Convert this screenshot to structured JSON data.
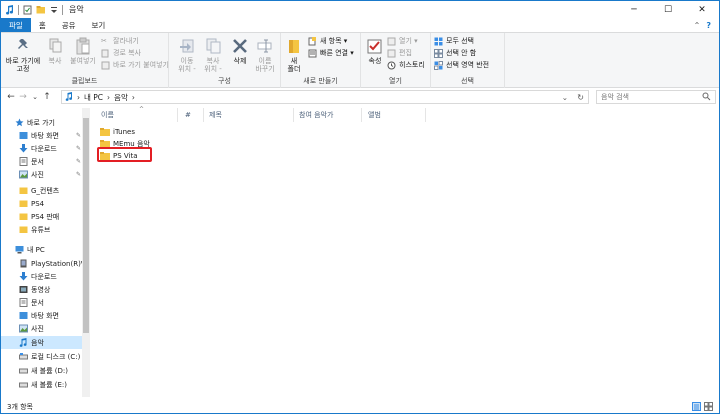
{
  "window": {
    "title": "음악",
    "minimize": "─",
    "maximize": "☐",
    "close": "✕"
  },
  "tabs": [
    {
      "label": "파일"
    },
    {
      "label": "홈"
    },
    {
      "label": "공유"
    },
    {
      "label": "보기"
    }
  ],
  "tabs_right": {
    "collapse": "⌃",
    "help": "?"
  },
  "ribbon": {
    "clipboard": {
      "pin_label": "바로 가기에\n고정",
      "copy_label": "복사",
      "paste_label": "붙여넣기",
      "cut_label": "잘라내기",
      "copy_path_label": "경로 복사",
      "paste_shortcut_label": "바로 가기 붙여넣기",
      "group_label": "클립보드"
    },
    "organize": {
      "move_label": "이동\n위치 -",
      "copy_to_label": "복사\n위치 -",
      "delete_label": "삭제",
      "rename_label": "이름\n바꾸기",
      "group_label": "구성"
    },
    "new": {
      "folder_label": "새\n폴더",
      "new_item_label": "새 항목 ▾",
      "easy_access_label": "빠른 연결 ▾",
      "group_label": "새로 만들기"
    },
    "open": {
      "properties_label": "속성",
      "open_label": "열기 ▾",
      "edit_label": "편집",
      "history_label": "히스토리",
      "group_label": "열기"
    },
    "select": {
      "select_all_label": "모두 선택",
      "select_none_label": "선택 안 함",
      "invert_label": "선택 영역 반전",
      "group_label": "선택"
    }
  },
  "address": {
    "back": "←",
    "forward": "→",
    "recent": "⌄",
    "up": "↑",
    "path": [
      "내 PC",
      "음악"
    ],
    "sep": "›",
    "dropdown": "⌄",
    "refresh": "↻",
    "search_placeholder": "음악 검색"
  },
  "nav": {
    "items": [
      {
        "label": "바로 가기",
        "pin": ""
      },
      {
        "label": "바탕 화면",
        "pin": "✎"
      },
      {
        "label": "다운로드",
        "pin": "✎"
      },
      {
        "label": "문서",
        "pin": "✎"
      },
      {
        "label": "사진",
        "pin": "✎"
      },
      {
        "label": "G_컨텐츠",
        "pin": ""
      },
      {
        "label": "PS4",
        "pin": ""
      },
      {
        "label": "PS4 판매",
        "pin": ""
      },
      {
        "label": "유튜브",
        "pin": ""
      },
      {
        "label": "내 PC",
        "pin": ""
      },
      {
        "label": "PlayStation(R)Vi",
        "pin": ""
      },
      {
        "label": "다운로드",
        "pin": ""
      },
      {
        "label": "동영상",
        "pin": ""
      },
      {
        "label": "문서",
        "pin": ""
      },
      {
        "label": "바탕 화면",
        "pin": ""
      },
      {
        "label": "사진",
        "pin": ""
      },
      {
        "label": "음악",
        "pin": ""
      },
      {
        "label": "로컬 디스크 (C:)",
        "pin": ""
      },
      {
        "label": "새 볼륨 (D:)",
        "pin": ""
      },
      {
        "label": "새 볼륨 (E:)",
        "pin": ""
      }
    ]
  },
  "columns": [
    {
      "label": "이름"
    },
    {
      "label": "#"
    },
    {
      "label": "제목"
    },
    {
      "label": "참여 음악가"
    },
    {
      "label": "앨범"
    }
  ],
  "files": [
    {
      "name": "iTunes"
    },
    {
      "name": "MEmu 음악"
    },
    {
      "name": "PS Vita"
    }
  ],
  "status": {
    "count": "3개 항목"
  },
  "colors": {
    "accent": "#1979ca",
    "folder": "#f4c542",
    "highlight": "#e31e24",
    "selected": "#cce8ff"
  }
}
